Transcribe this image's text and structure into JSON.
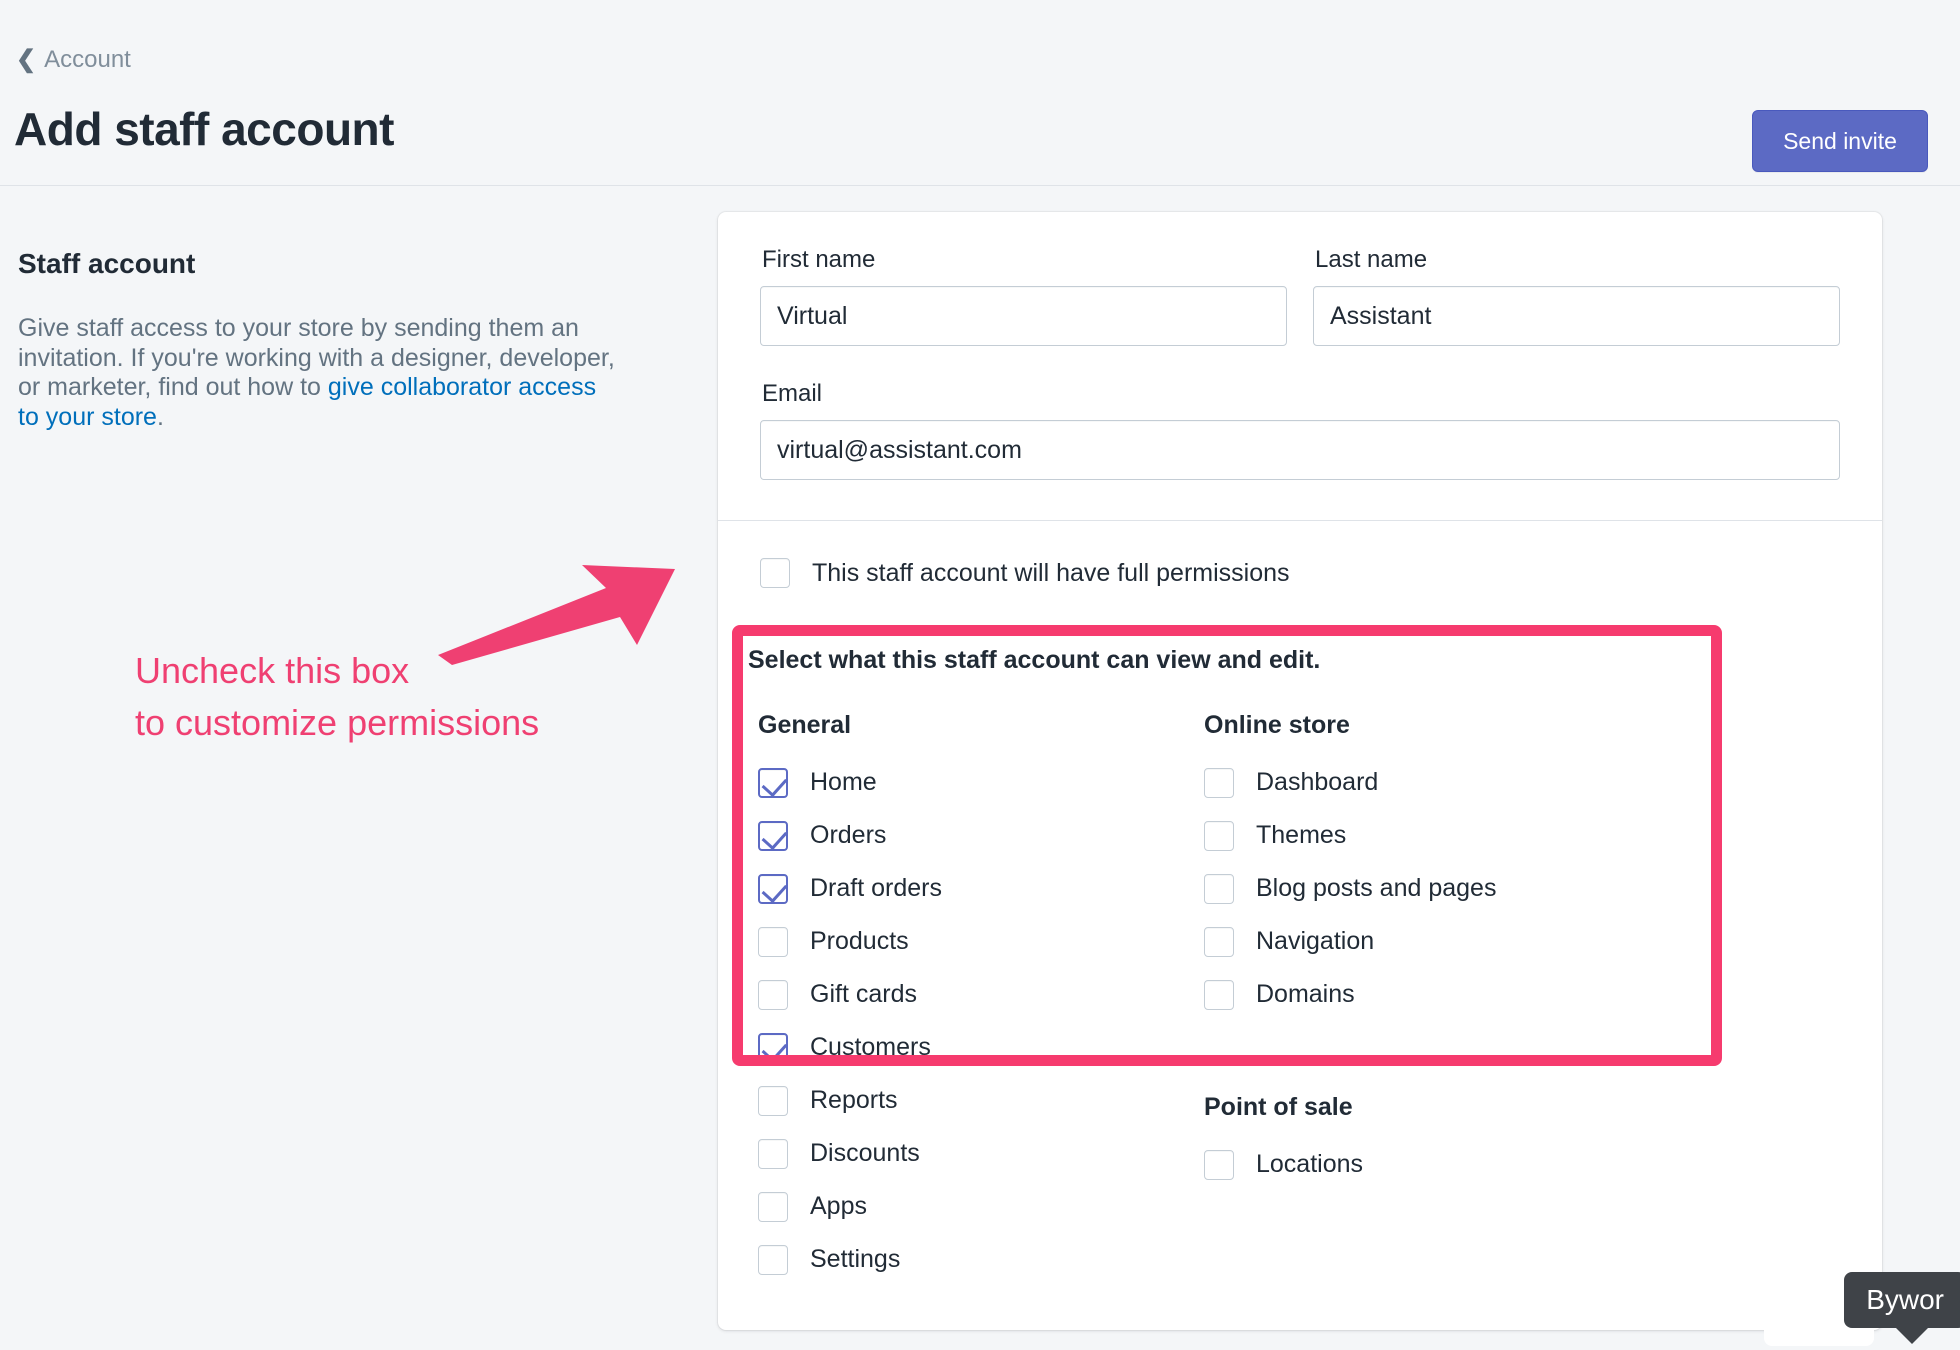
{
  "header": {
    "breadcrumb_label": "Account",
    "breadcrumb_icon": "chevron-left-icon",
    "title": "Add staff account",
    "primary_action": "Send invite",
    "primary_action_color": "#5c6ac4"
  },
  "sidebar": {
    "heading": "Staff account",
    "body_before_link": "Give staff access to your store by sending them an invitation. If you're working with a designer, developer, or marketer, find out how to ",
    "link_text": "give collaborator access to your store",
    "body_after_link": ".",
    "link_color": "#006fbb"
  },
  "form": {
    "first_name": {
      "label": "First name",
      "value": "Virtual",
      "placeholder": ""
    },
    "last_name": {
      "label": "Last name",
      "value": "Assistant",
      "placeholder": ""
    },
    "email": {
      "label": "Email",
      "value": "virtual@assistant.com",
      "placeholder": ""
    }
  },
  "permissions": {
    "full_permissions_label": "This staff account will have full permissions",
    "full_permissions_checked": false,
    "subtitle": "Select what this staff account can view and edit.",
    "groups": [
      {
        "name": "General",
        "items": [
          {
            "label": "Home",
            "checked": true
          },
          {
            "label": "Orders",
            "checked": true
          },
          {
            "label": "Draft orders",
            "checked": true
          },
          {
            "label": "Products",
            "checked": false
          },
          {
            "label": "Gift cards",
            "checked": false
          },
          {
            "label": "Customers",
            "checked": true
          },
          {
            "label": "Reports",
            "checked": false
          },
          {
            "label": "Discounts",
            "checked": false
          },
          {
            "label": "Apps",
            "checked": false
          },
          {
            "label": "Settings",
            "checked": false
          }
        ]
      },
      {
        "name": "Online store",
        "items": [
          {
            "label": "Dashboard",
            "checked": false
          },
          {
            "label": "Themes",
            "checked": false
          },
          {
            "label": "Blog posts and pages",
            "checked": false
          },
          {
            "label": "Navigation",
            "checked": false
          },
          {
            "label": "Domains",
            "checked": false
          }
        ]
      },
      {
        "name": "Point of sale",
        "items": [
          {
            "label": "Locations",
            "checked": false
          }
        ]
      }
    ],
    "checkbox_accent_color": "#5c6ac4"
  },
  "annotation": {
    "text": "Uncheck this box\nto customize permissions",
    "color": "#ef4072",
    "arrow_icon": "arrow-pointing-up-right-icon",
    "highlight_color": "#f63b6e"
  },
  "tooltip": {
    "text": "Bywor",
    "background": "#3f4348"
  }
}
